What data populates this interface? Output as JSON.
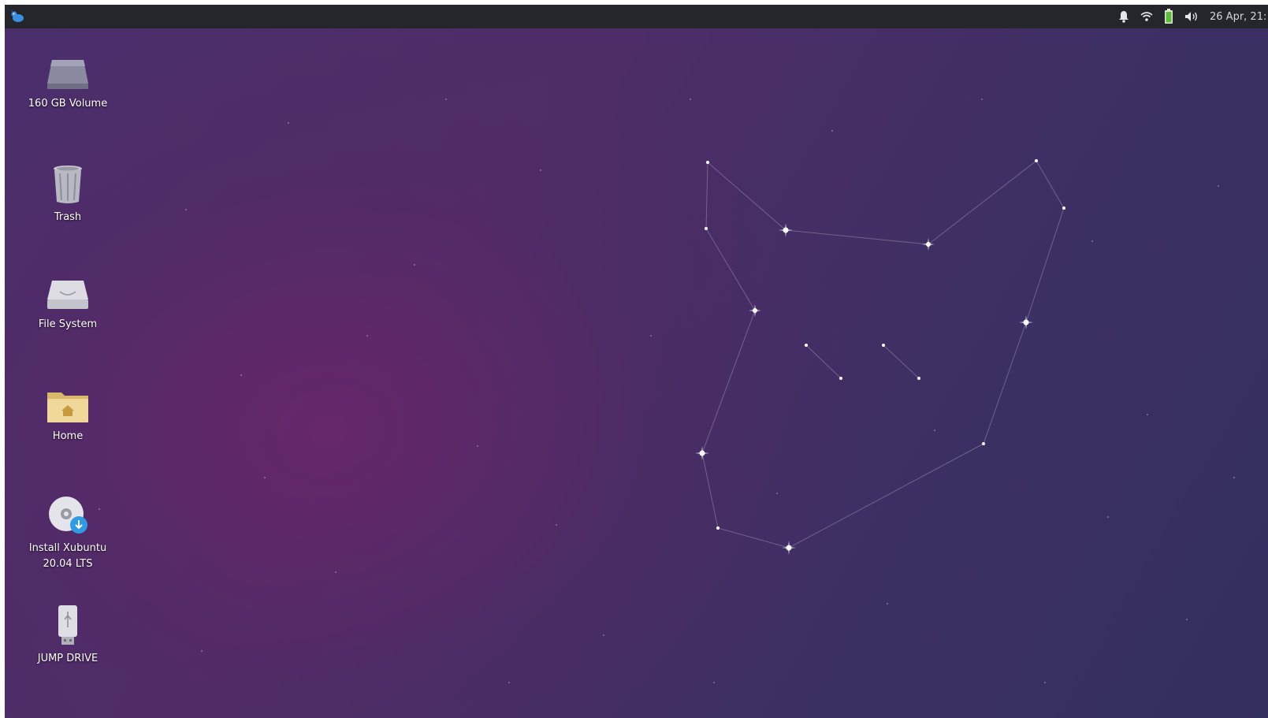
{
  "panel": {
    "menu_icon": "xubuntu-mouse-icon",
    "tray": {
      "notification_icon": "bell-icon",
      "network_icon": "wifi-icon",
      "battery_icon": "battery-icon",
      "volume_icon": "volume-icon",
      "clock": "26 Apr, 21:"
    }
  },
  "desktop": {
    "icons": [
      {
        "label": "160 GB Volume",
        "icon": "drive-icon"
      },
      {
        "label": "Trash",
        "icon": "trash-icon"
      },
      {
        "label": "File System",
        "icon": "harddisk-icon"
      },
      {
        "label": "Home",
        "icon": "home-folder-icon"
      },
      {
        "label": "Install Xubuntu\n20.04 LTS",
        "icon": "installer-disc-icon"
      },
      {
        "label": "JUMP DRIVE",
        "icon": "usb-drive-icon"
      }
    ]
  },
  "colors": {
    "panel_bg": "#25262c",
    "wallpaper_primary": "#4a2f6c",
    "wallpaper_glow": "#7a226e",
    "accent_blue": "#2f9be6"
  }
}
